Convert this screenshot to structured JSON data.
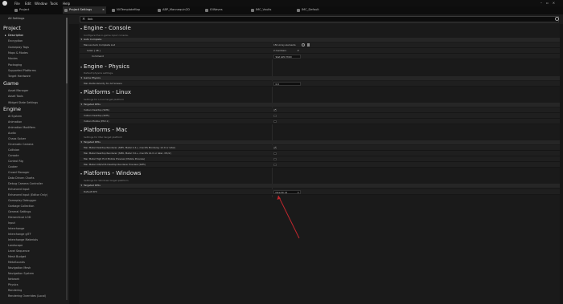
{
  "menu": [
    "File",
    "Edit",
    "Window",
    "Tools",
    "Help"
  ],
  "project_label": "Project",
  "tabs": [
    {
      "label": "Project Settings",
      "active": true
    },
    {
      "label": "NVTemplateMap",
      "active": false
    },
    {
      "label": "ABP_Mannequin2D",
      "active": false
    },
    {
      "label": "IOWaves",
      "active": false
    },
    {
      "label": "IMC_Vaults",
      "active": false
    },
    {
      "label": "IMC_Default",
      "active": false
    }
  ],
  "search": {
    "value": "link"
  },
  "sidebar": {
    "all_settings": "All Settings",
    "sections": [
      {
        "title": "Project",
        "items": [
          "Description",
          "Encryption",
          "Gameplay Tags",
          "Maps & Modes",
          "Movies",
          "Packaging",
          "Supported Platforms",
          "Target Hardware"
        ]
      },
      {
        "title": "Game",
        "items": [
          "Asset Manager",
          "Asset Tools",
          "Widget State Settings"
        ]
      },
      {
        "title": "Engine",
        "items": [
          "AI System",
          "Animation",
          "Animation Modifiers",
          "Audio",
          "Chaos Solver",
          "Cinematic Camera",
          "Collision",
          "Console",
          "Control Rig",
          "Cooker",
          "Crowd Manager",
          "Data Driven Charts",
          "Debug Camera Controller",
          "Enhanced Input",
          "Enhanced Input (Editor Only)",
          "Gameplay Debugger",
          "Garbage Collection",
          "General Settings",
          "Hierarchical LOD",
          "Input",
          "Interchange",
          "Interchange glTF",
          "Interchange Materials",
          "Landscape",
          "Level Sequence",
          "Mesh Budget",
          "MetaSounds",
          "Navigation Mesh",
          "Navigation System",
          "Network",
          "Physics",
          "Rendering",
          "Rendering Overrides (Local)"
        ]
      }
    ],
    "selected": "Description"
  },
  "content": {
    "console": {
      "title": "Engine - Console",
      "desc": "Configure the in-game input console.",
      "category": "Auto Complete",
      "rows": [
        {
          "label": "Manual Auto Complete List",
          "count": "150 Array elements"
        },
        {
          "label": "Index [ 48 ]",
          "count": "2 members"
        },
        {
          "label": "Command",
          "value": "Stat GPU Hitch"
        }
      ]
    },
    "physics": {
      "title": "Engine - Physics",
      "desc": "Default physics settings.",
      "category": "Game Physics",
      "rows": [
        {
          "label": "Max Delta Velocity for All Solvers",
          "value": "0.0"
        }
      ]
    },
    "linux": {
      "title": "Platforms - Linux",
      "desc": "Settings for Linux target platform",
      "category": "Targeted RHIs",
      "rows": [
        {
          "label": "Vulkan Desktop (SM6)",
          "checked": true
        },
        {
          "label": "Vulkan Desktop (SM5)",
          "checked": false
        },
        {
          "label": "Vulkan Mobile (ES3.1)",
          "checked": false
        }
      ]
    },
    "mac": {
      "title": "Platforms - Mac",
      "desc": "Settings for Mac target platform",
      "category": "Targeted RHIs",
      "rows": [
        {
          "label": "Mac Metal Desktop Renderer (SM5, Metal 2.4+, macOS Monterey 12.0 or later)",
          "checked": true
        },
        {
          "label": "Mac Metal Desktop Renderer (SM6, Metal 3.0+, macOS 14.0 or later, M1/2)",
          "checked": false
        },
        {
          "label": "Mac Metal High End Mobile Preview (Mobile Preview)",
          "checked": false
        },
        {
          "label": "Mac Metal iOS/tvOS Desktop Renderer Preview (SM5)",
          "checked": false
        }
      ]
    },
    "windows": {
      "title": "Platforms - Windows",
      "desc": "Settings for Windows target platform",
      "category": "Targeted RHIs",
      "rows": [
        {
          "label": "Default RHI",
          "value": "DirectX 12"
        }
      ]
    }
  },
  "colors": {
    "annotation_arrow": "#c0262d",
    "accent": "#e6e6e6"
  }
}
